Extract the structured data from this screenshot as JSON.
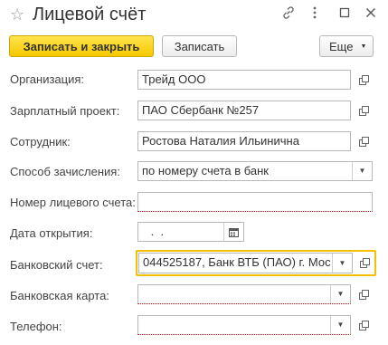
{
  "window": {
    "title": "Лицевой счёт"
  },
  "toolbar": {
    "save_close_label": "Записать и закрыть",
    "save_label": "Записать",
    "more_label": "Еще"
  },
  "form": {
    "organization": {
      "label": "Организация:",
      "value": "Трейд ООО"
    },
    "salary_project": {
      "label": "Зарплатный проект:",
      "value": "ПАО Сбербанк №257"
    },
    "employee": {
      "label": "Сотрудник:",
      "value": "Ростова Наталия Ильинична"
    },
    "crediting_method": {
      "label": "Способ зачисления:",
      "value": "по номеру счета в банк"
    },
    "account_number": {
      "label": "Номер лицевого счета:",
      "value": ""
    },
    "open_date": {
      "label": "Дата открытия:",
      "value": " .  . "
    },
    "bank_account": {
      "label": "Банковский счет:",
      "value": "044525187, Банк ВТБ (ПАО) г. Мос"
    },
    "bank_card": {
      "label": "Банковская карта:",
      "value": ""
    },
    "phone": {
      "label": "Телефон:",
      "value": ""
    }
  },
  "colors": {
    "primary_button": "#f5c800",
    "focus_border": "#f5c000",
    "required_underline": "#d00000"
  },
  "icons": [
    "star-icon",
    "link-icon",
    "kebab-menu-icon",
    "maximize-icon",
    "close-icon",
    "calendar-icon",
    "open-icon",
    "chevron-down-icon"
  ]
}
